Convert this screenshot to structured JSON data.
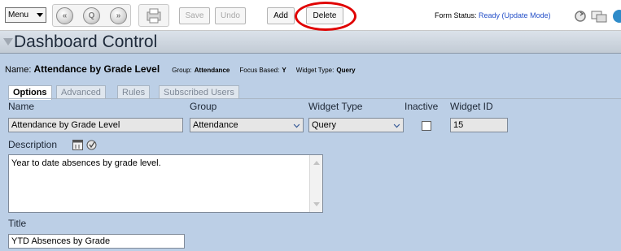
{
  "toolbar": {
    "menu_label": "Menu",
    "nav": [
      {
        "icon": "first-record-icon",
        "glyph": "«"
      },
      {
        "icon": "search-icon",
        "glyph": "Q"
      },
      {
        "icon": "last-record-icon",
        "glyph": "»"
      }
    ],
    "buttons": {
      "save": "Save",
      "undo": "Undo",
      "add": "Add",
      "delete": "Delete"
    },
    "form_status_label": "Form Status:",
    "form_status_value": "Ready (Update Mode)"
  },
  "header": {
    "title": "Dashboard Control"
  },
  "summary": {
    "name_label": "Name:",
    "name_value": "Attendance by Grade Level",
    "group_label": "Group:",
    "group_value": "Attendance",
    "focus_label": "Focus Based:",
    "focus_value": "Y",
    "type_label": "Widget Type:",
    "type_value": "Query"
  },
  "tabs": [
    {
      "label": "Options",
      "active": true
    },
    {
      "label": "Advanced",
      "active": false
    },
    {
      "label": "Rules",
      "active": false
    },
    {
      "label": "Subscribed Users",
      "active": false
    }
  ],
  "form": {
    "name_label": "Name",
    "name_value": "Attendance by Grade Level",
    "group_label": "Group",
    "group_value": "Attendance",
    "widget_type_label": "Widget Type",
    "widget_type_value": "Query",
    "inactive_label": "Inactive",
    "inactive_checked": false,
    "widget_id_label": "Widget ID",
    "widget_id_value": "15",
    "description_label": "Description",
    "description_value": "Year to date absences by grade level.",
    "title_label": "Title",
    "title_value": "YTD Absences by Grade"
  },
  "colors": {
    "form_background": "#bccfe6",
    "status_text": "#2550c8",
    "highlight_circle": "#e00000"
  }
}
